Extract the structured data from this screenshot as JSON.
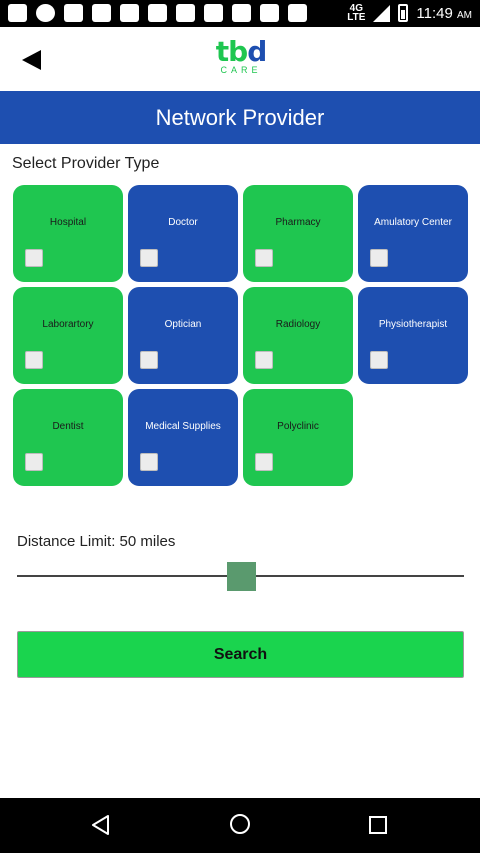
{
  "status_bar": {
    "left_icons": [
      "mail-icon",
      "whatsapp-icon",
      "gmail-icon",
      "gmail-icon",
      "app-icon",
      "cleaner-icon",
      "news-icon",
      "cleaner-icon",
      "cast-icon",
      "image-icon",
      "cleaner-icon"
    ],
    "network_top": "4G",
    "network_label": "LTE",
    "time": "11:49",
    "ampm": "AM"
  },
  "header": {
    "logo_text_main_left": "tb",
    "logo_text_main_right": "d",
    "logo_subtext": "CARE"
  },
  "title": "Network Provider",
  "section_label": "Select Provider Type",
  "provider_types": [
    {
      "label": "Hospital",
      "color": "green",
      "checked": false
    },
    {
      "label": "Doctor",
      "color": "blue",
      "checked": false
    },
    {
      "label": "Pharmacy",
      "color": "green",
      "checked": false
    },
    {
      "label": "Amulatory Center",
      "color": "blue",
      "checked": false
    },
    {
      "label": "Laborartory",
      "color": "green",
      "checked": false
    },
    {
      "label": "Optician",
      "color": "blue",
      "checked": false
    },
    {
      "label": "Radiology",
      "color": "green",
      "checked": false
    },
    {
      "label": "Physiotherapist",
      "color": "blue",
      "checked": false
    },
    {
      "label": "Dentist",
      "color": "green",
      "checked": false
    },
    {
      "label": "Medical Supplies",
      "color": "blue",
      "checked": false
    },
    {
      "label": "Polyclinic",
      "color": "green",
      "checked": false
    }
  ],
  "distance": {
    "label": "Distance Limit: 50 miles",
    "value_fraction": 0.5
  },
  "search_label": "Search",
  "colors": {
    "brand_blue": "#1e4fb0",
    "brand_green": "#1fc650",
    "search_green": "#1ad44e",
    "slider_thumb": "#5a9a6e"
  }
}
